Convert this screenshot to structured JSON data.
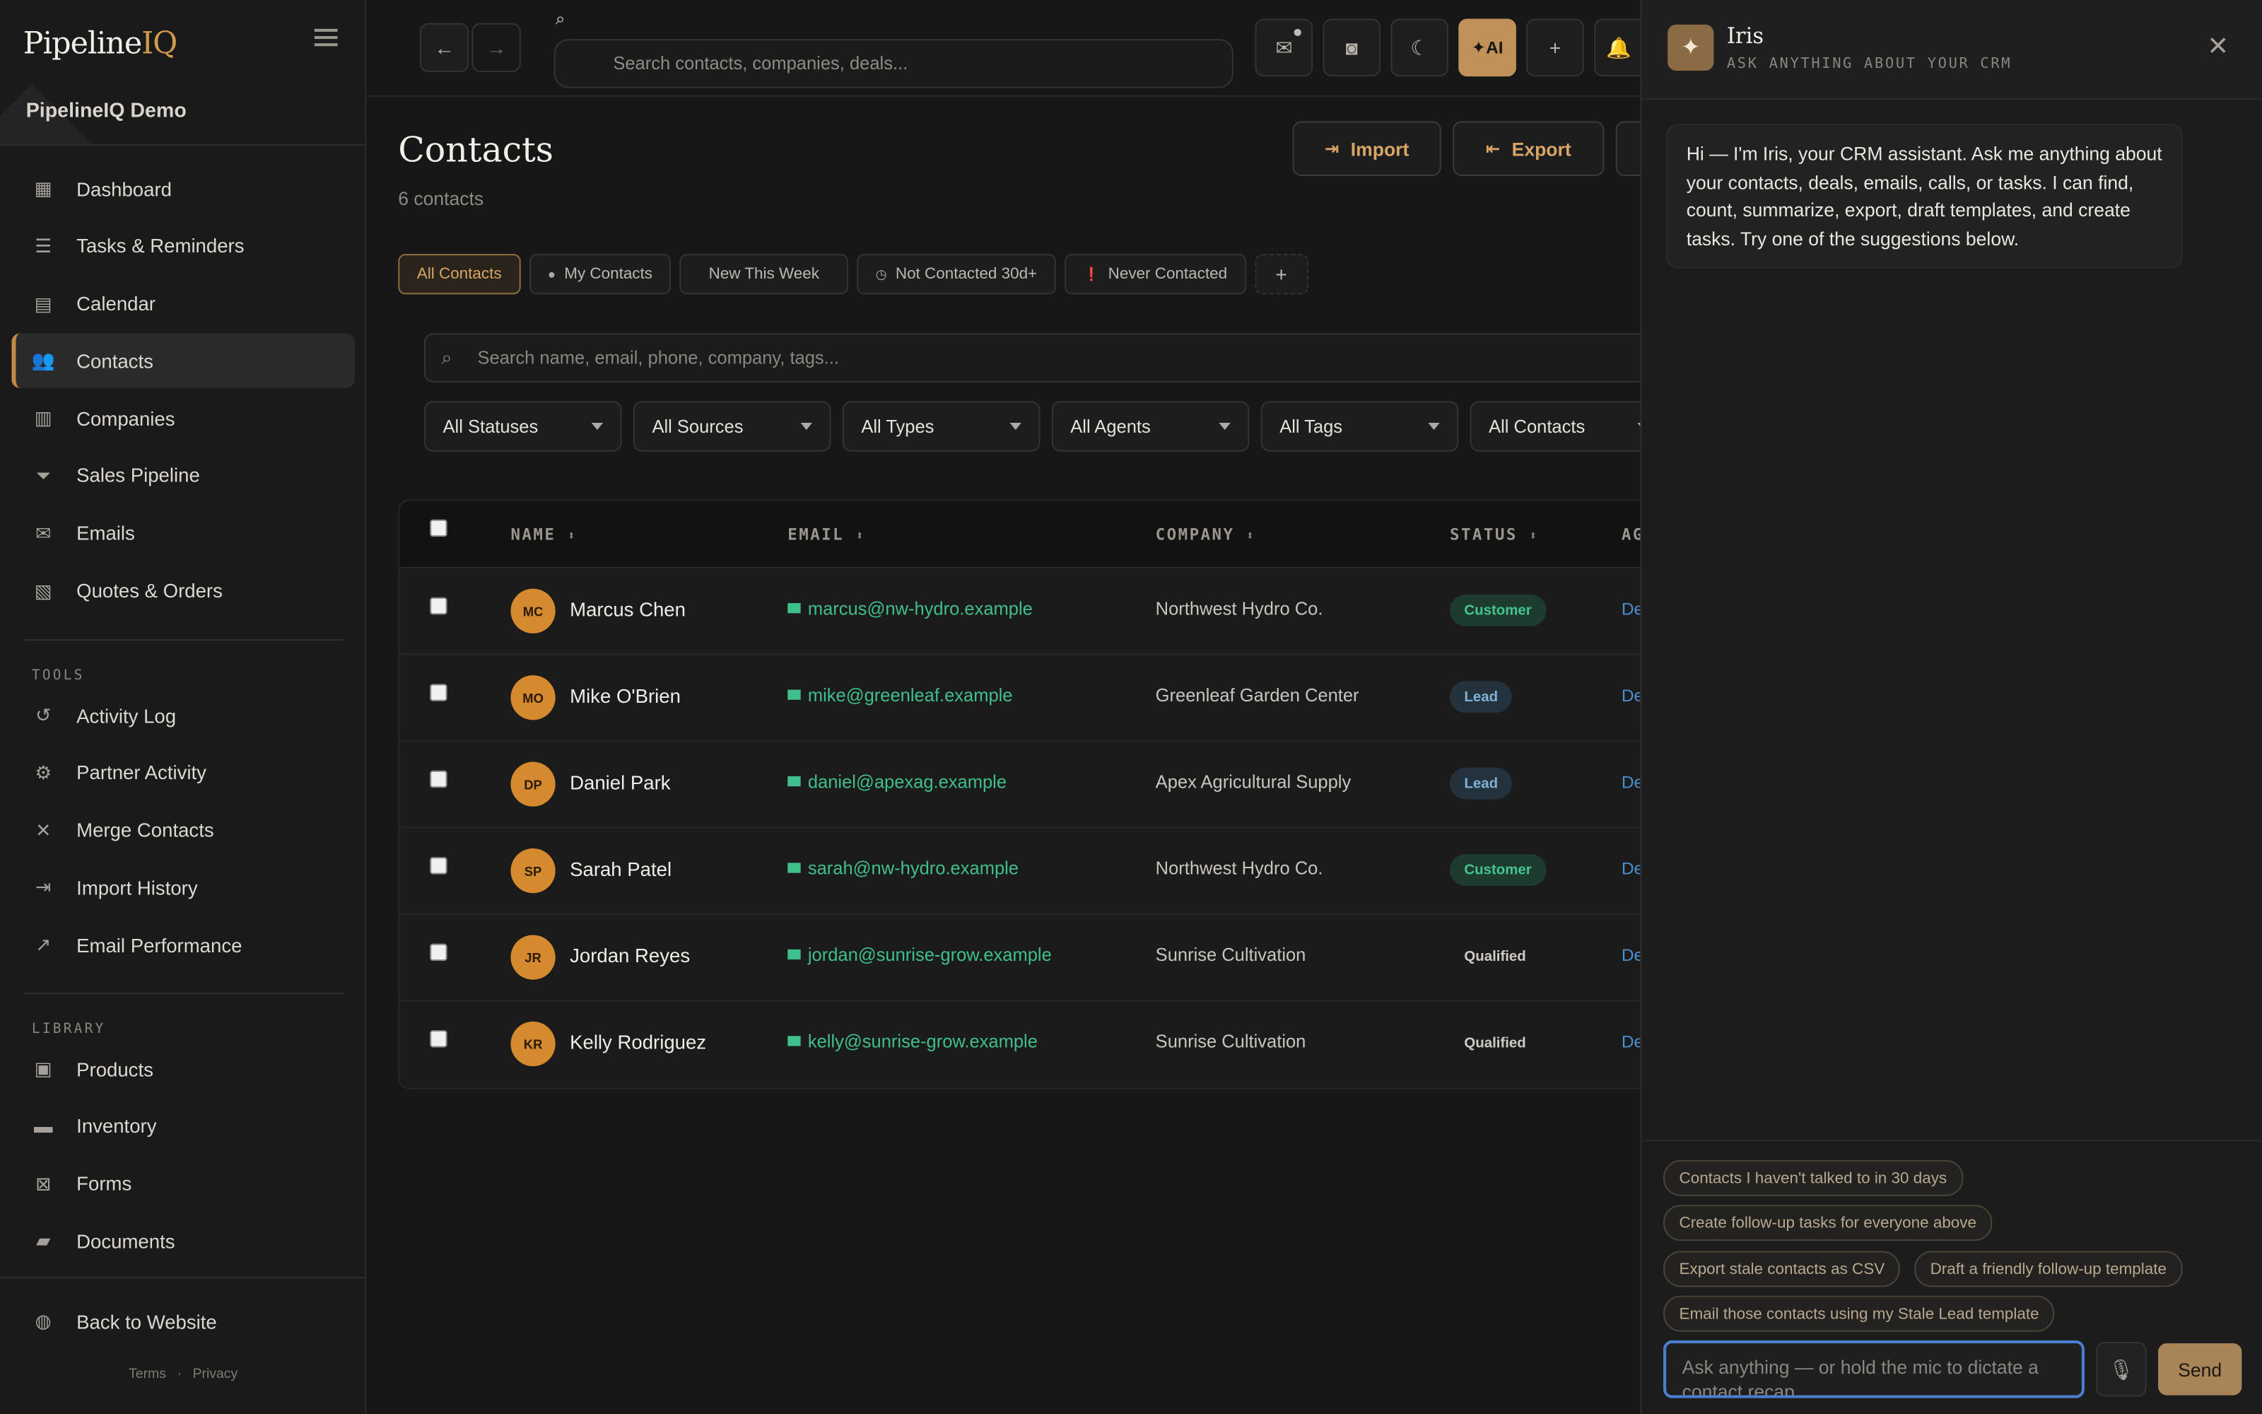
{
  "app": {
    "brand_main": "Pipeline",
    "brand_accent": "IQ",
    "workspace": "PipelineIQ Demo",
    "accent_color": "#c28a44"
  },
  "sidebar": {
    "main_items": [
      {
        "label": "Dashboard",
        "icon": "grid-icon"
      },
      {
        "label": "Tasks & Reminders",
        "icon": "checklist-icon"
      },
      {
        "label": "Calendar",
        "icon": "calendar-icon"
      },
      {
        "label": "Contacts",
        "icon": "users-icon",
        "active": true
      },
      {
        "label": "Companies",
        "icon": "building-icon"
      },
      {
        "label": "Sales Pipeline",
        "icon": "filter-icon"
      },
      {
        "label": "Emails",
        "icon": "envelope-icon"
      },
      {
        "label": "Quotes & Orders",
        "icon": "invoice-icon"
      }
    ],
    "tools_label": "TOOLS",
    "tools_items": [
      {
        "label": "Activity Log",
        "icon": "history-icon"
      },
      {
        "label": "Partner Activity",
        "icon": "user-gear-icon"
      },
      {
        "label": "Merge Contacts",
        "icon": "merge-icon"
      },
      {
        "label": "Import History",
        "icon": "file-import-icon"
      },
      {
        "label": "Email Performance",
        "icon": "chart-line-icon"
      }
    ],
    "library_label": "LIBRARY",
    "library_items": [
      {
        "label": "Products",
        "icon": "boxes-icon"
      },
      {
        "label": "Inventory",
        "icon": "warehouse-icon"
      },
      {
        "label": "Forms",
        "icon": "form-icon"
      },
      {
        "label": "Documents",
        "icon": "folder-open-icon"
      }
    ],
    "back_label": "Back to Website",
    "terms": "Terms",
    "sep": "·",
    "privacy": "Privacy"
  },
  "topbar": {
    "search_placeholder": "Search contacts, companies, deals...",
    "ai_label": "AI"
  },
  "page": {
    "title": "Contacts",
    "count": "6 contacts",
    "import_label": "Import",
    "export_label": "Export"
  },
  "chips": [
    {
      "label": "All Contacts",
      "active": true
    },
    {
      "label": "My Contacts",
      "icon": "user-icon"
    },
    {
      "label": "New This Week"
    },
    {
      "label": "Not Contacted 30d+",
      "icon": "clock-icon"
    },
    {
      "label": "Never Contacted",
      "icon": "alert-icon"
    }
  ],
  "list_search_placeholder": "Search name, email, phone, company, tags...",
  "filters": [
    "All Statuses",
    "All Sources",
    "All Types",
    "All Agents",
    "All Tags",
    "All Contacts"
  ],
  "table": {
    "headers": {
      "name": "NAME",
      "email": "EMAIL",
      "company": "COMPANY",
      "status": "STATUS",
      "agent": "AG"
    },
    "rows": [
      {
        "initials": "MC",
        "name": "Marcus Chen",
        "email": "marcus@nw-hydro.example",
        "company": "Northwest Hydro Co.",
        "status": "Customer",
        "status_kind": "customer",
        "agent": "De"
      },
      {
        "initials": "MO",
        "name": "Mike O'Brien",
        "email": "mike@greenleaf.example",
        "company": "Greenleaf Garden Center",
        "status": "Lead",
        "status_kind": "lead",
        "agent": "De"
      },
      {
        "initials": "DP",
        "name": "Daniel Park",
        "email": "daniel@apexag.example",
        "company": "Apex Agricultural Supply",
        "status": "Lead",
        "status_kind": "lead",
        "agent": "De"
      },
      {
        "initials": "SP",
        "name": "Sarah Patel",
        "email": "sarah@nw-hydro.example",
        "company": "Northwest Hydro Co.",
        "status": "Customer",
        "status_kind": "customer",
        "agent": "De"
      },
      {
        "initials": "JR",
        "name": "Jordan Reyes",
        "email": "jordan@sunrise-grow.example",
        "company": "Sunrise Cultivation",
        "status": "Qualified",
        "status_kind": "qualified",
        "agent": "De"
      },
      {
        "initials": "KR",
        "name": "Kelly Rodriguez",
        "email": "kelly@sunrise-grow.example",
        "company": "Sunrise Cultivation",
        "status": "Qualified",
        "status_kind": "qualified",
        "agent": "De"
      }
    ]
  },
  "iris": {
    "name": "Iris",
    "subtitle": "ASK ANYTHING ABOUT YOUR CRM",
    "greeting": "Hi — I'm Iris, your CRM assistant. Ask me anything about your contacts, deals, emails, calls, or tasks. I can find, count, summarize, export, draft templates, and create tasks. Try one of the suggestions below.",
    "suggestions": [
      "Contacts I haven't talked to in 30 days",
      "Create follow-up tasks for everyone above",
      "Export stale contacts as CSV",
      "Draft a friendly follow-up template",
      "Email those contacts using my Stale Lead template"
    ],
    "input_placeholder": "Ask anything — or hold the mic to dictate a contact recap",
    "send_label": "Send"
  }
}
